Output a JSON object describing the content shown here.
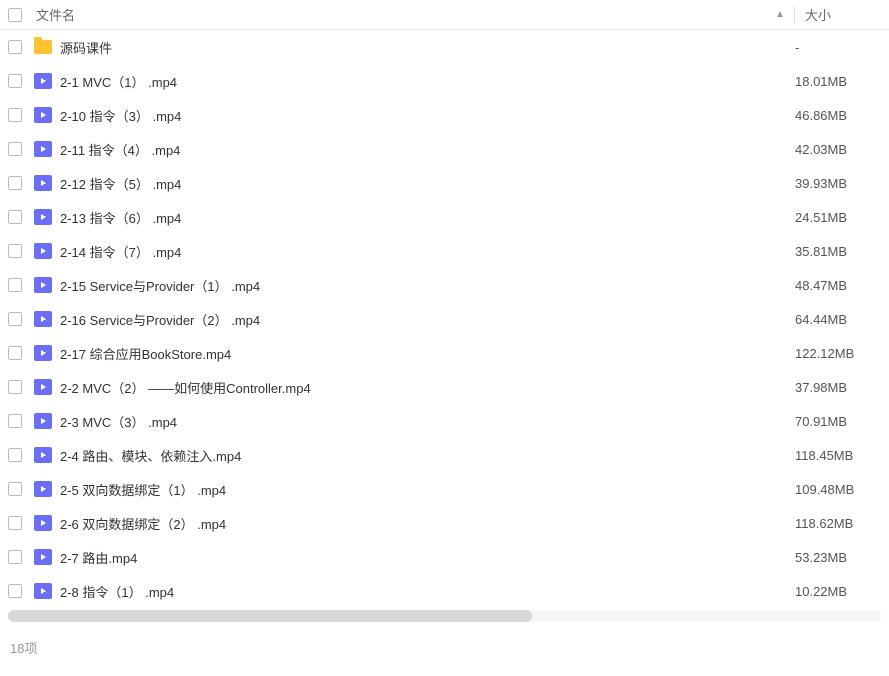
{
  "header": {
    "filename_label": "文件名",
    "size_label": "大小",
    "sort_indicator": "▲"
  },
  "rows": [
    {
      "type": "folder",
      "name": "源码课件",
      "size": "-"
    },
    {
      "type": "video",
      "name": "2-1 MVC（1） .mp4",
      "size": "18.01MB"
    },
    {
      "type": "video",
      "name": "2-10 指令（3） .mp4",
      "size": "46.86MB"
    },
    {
      "type": "video",
      "name": "2-11 指令（4） .mp4",
      "size": "42.03MB"
    },
    {
      "type": "video",
      "name": "2-12 指令（5） .mp4",
      "size": "39.93MB"
    },
    {
      "type": "video",
      "name": "2-13 指令（6） .mp4",
      "size": "24.51MB"
    },
    {
      "type": "video",
      "name": "2-14 指令（7） .mp4",
      "size": "35.81MB"
    },
    {
      "type": "video",
      "name": "2-15 Service与Provider（1） .mp4",
      "size": "48.47MB"
    },
    {
      "type": "video",
      "name": "2-16 Service与Provider（2） .mp4",
      "size": "64.44MB"
    },
    {
      "type": "video",
      "name": "2-17 综合应用BookStore.mp4",
      "size": "122.12MB"
    },
    {
      "type": "video",
      "name": "2-2 MVC（2） ——如何使用Controller.mp4",
      "size": "37.98MB"
    },
    {
      "type": "video",
      "name": "2-3 MVC（3） .mp4",
      "size": "70.91MB"
    },
    {
      "type": "video",
      "name": "2-4 路由、模块、依赖注入.mp4",
      "size": "118.45MB"
    },
    {
      "type": "video",
      "name": "2-5 双向数据绑定（1） .mp4",
      "size": "109.48MB"
    },
    {
      "type": "video",
      "name": "2-6 双向数据绑定（2） .mp4",
      "size": "118.62MB"
    },
    {
      "type": "video",
      "name": "2-7 路由.mp4",
      "size": "53.23MB"
    },
    {
      "type": "video",
      "name": "2-8 指令（1） .mp4",
      "size": "10.22MB"
    }
  ],
  "status": {
    "count_label": "18项"
  }
}
